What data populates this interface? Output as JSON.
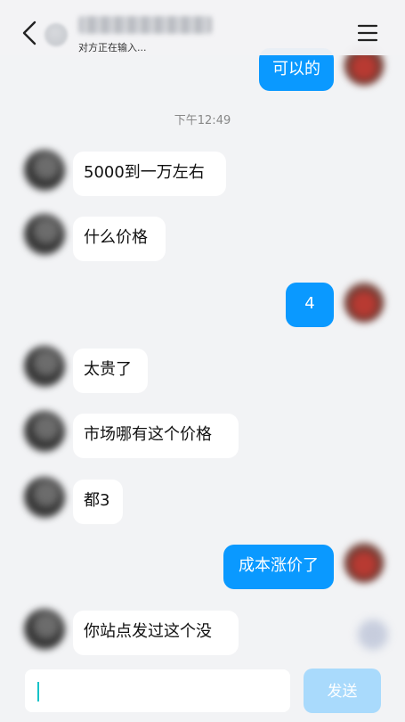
{
  "header": {
    "typing_status": "对方正在输入..."
  },
  "timestamp": "下午12:49",
  "messages": [
    {
      "side": "out",
      "text": "可以的"
    },
    {
      "side": "in",
      "text": "5000到一万左右"
    },
    {
      "side": "in",
      "text": "什么价格"
    },
    {
      "side": "out",
      "text": "4"
    },
    {
      "side": "in",
      "text": "太贵了"
    },
    {
      "side": "in",
      "text": "市场哪有这个价格"
    },
    {
      "side": "in",
      "text": "都3"
    },
    {
      "side": "out",
      "text": "成本涨价了"
    },
    {
      "side": "in",
      "text": "你站点发过这个没"
    }
  ],
  "input": {
    "value": "",
    "send_label": "发送"
  },
  "colors": {
    "out_bubble": "#0a99ff",
    "in_bubble": "#ffffff",
    "send_disabled": "#a9dafc"
  },
  "icons": [
    "back-icon",
    "menu-icon"
  ]
}
